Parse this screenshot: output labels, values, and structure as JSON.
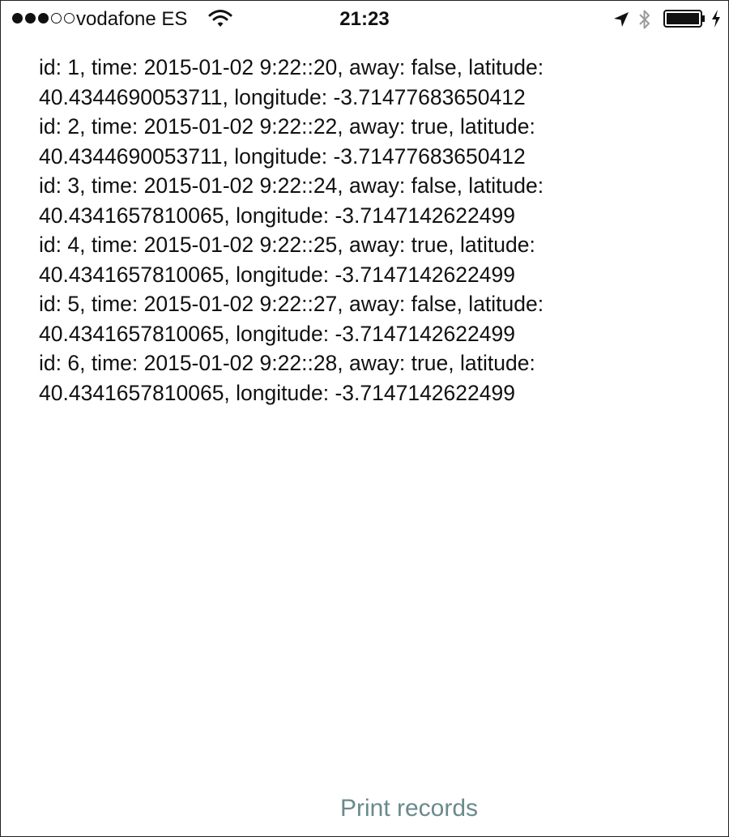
{
  "status_bar": {
    "carrier": "vodafone ES",
    "time": "21:23",
    "signal_strength": 3,
    "signal_max": 5
  },
  "records": [
    "id: 1, time: 2015-01-02 9:22::20, away: false, latitude: 40.4344690053711, longitude: -3.71477683650412",
    "id: 2, time: 2015-01-02 9:22::22, away: true, latitude: 40.4344690053711, longitude: -3.71477683650412",
    "id: 3, time: 2015-01-02 9:22::24, away: false, latitude: 40.4341657810065, longitude: -3.7147142622499",
    "id: 4, time: 2015-01-02 9:22::25, away: true, latitude: 40.4341657810065, longitude: -3.7147142622499",
    "id: 5, time: 2015-01-02 9:22::27, away: false, latitude: 40.4341657810065, longitude: -3.7147142622499",
    "id: 6, time: 2015-01-02 9:22::28, away: true, latitude: 40.4341657810065, longitude: -3.7147142622499"
  ],
  "actions": {
    "print_label": "Print records"
  },
  "colors": {
    "button_tint": "#6a8a8d",
    "text": "#111111"
  }
}
